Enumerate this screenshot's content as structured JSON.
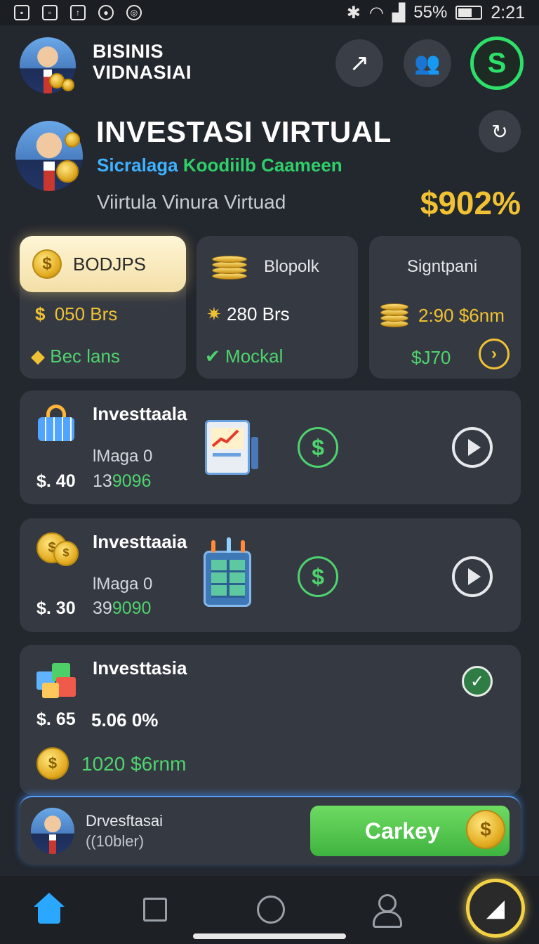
{
  "status_bar": {
    "battery": "55%",
    "time": "2:21"
  },
  "header": {
    "brand_line1": "BISINIS",
    "brand_line2": "VIDNASIAI",
    "brand_badge_letter": "S"
  },
  "hero": {
    "title": "INVESTASI VIRTUAL",
    "subtitle_blue": "Sicralaga",
    "subtitle_green": "Koodiilb Caameen",
    "description": "Viirtula Vinura Virtuad",
    "percent": "$902%"
  },
  "stats": [
    {
      "header": "BODJPS",
      "value": "050 Brs",
      "value_prefix": "$",
      "footer": "Bec lans"
    },
    {
      "header": "Blopolk",
      "value": "280 Brs",
      "footer": "Mockal"
    },
    {
      "header": "Signtpani",
      "value": "2:90 $6nm",
      "footer": "$J70"
    }
  ],
  "investments": [
    {
      "title": "Investtaala",
      "subtitle": "lMaga 0",
      "price": "$. 40",
      "number_white": "13",
      "number_green": "9096"
    },
    {
      "title": "Investtaaia",
      "subtitle": "lMaga 0",
      "price": "$. 30",
      "number_white": "39",
      "number_green": "9090"
    },
    {
      "title": "Investtasia",
      "price": "$. 65",
      "rate": "5.06 0%",
      "earning": "1020 $6rnm"
    }
  ],
  "cta": {
    "name": "Drvesftasai",
    "detail": "((10bler)",
    "button_label": "Carkey"
  },
  "icons": {
    "row_action": "dollar-icon",
    "row_open": "play-icon",
    "completed": "check-icon"
  },
  "colors": {
    "background": "#23272e",
    "card": "#353a42",
    "gold": "#f0c233",
    "green": "#4fd36e",
    "blue": "#3eb2ff",
    "nav_active": "#2aa8ff"
  }
}
